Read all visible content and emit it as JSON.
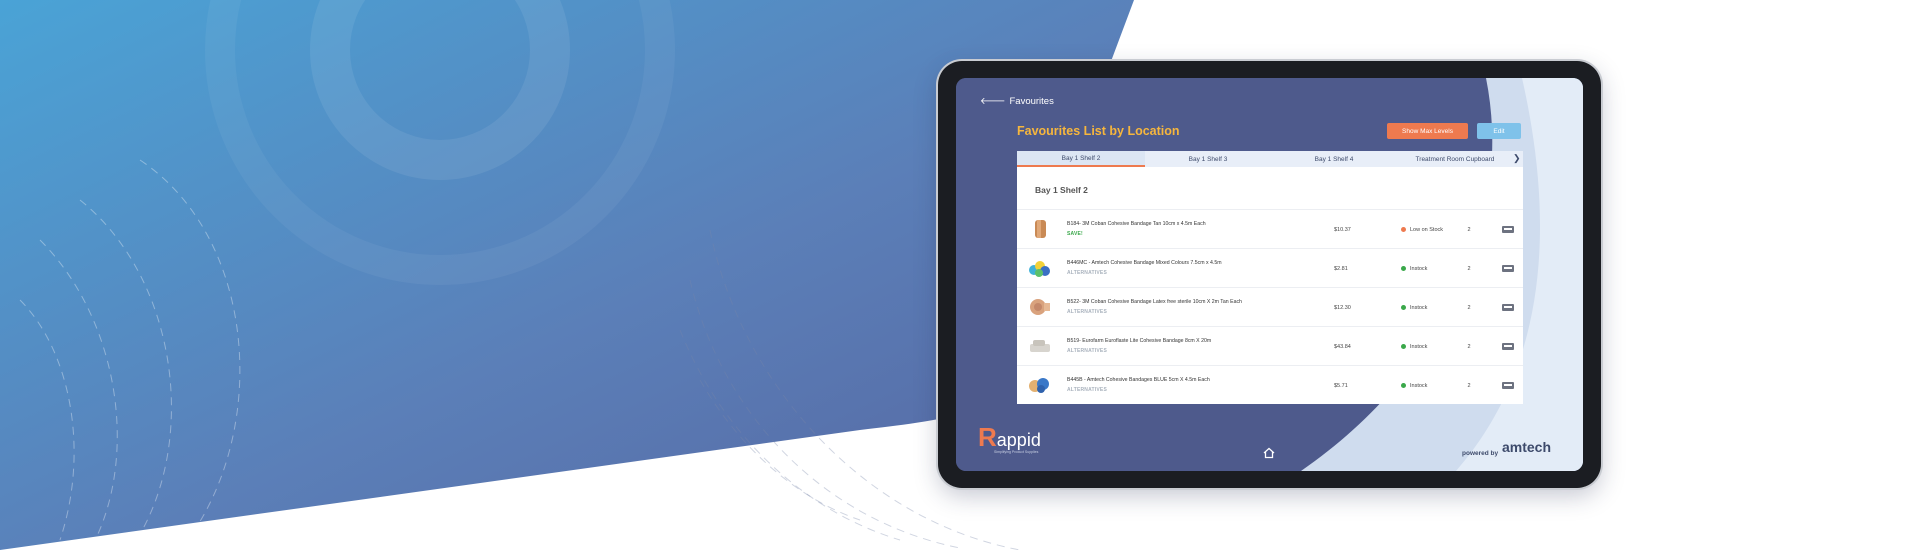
{
  "screen": {
    "back_label": "Favourites",
    "title": "Favourites List by Location",
    "buttons": {
      "show_max_levels": "Show Max Levels",
      "edit": "Edit"
    }
  },
  "tabs": [
    {
      "label": "Bay 1 Shelf 2",
      "active": true
    },
    {
      "label": "Bay 1 Shelf 3",
      "active": false
    },
    {
      "label": "Bay 1 Shelf 4",
      "active": false
    },
    {
      "label": "Treatment Room Cupboard",
      "active": false
    }
  ],
  "shelf_title": "Bay 1 Shelf 2",
  "products": [
    {
      "name": "B184- 3M Coban Cohesive Bandage Tan 10cm x 4.5m Each",
      "tag": "SAVE!",
      "tag_type": "save",
      "price": "$10.37",
      "status": "Low on Stock",
      "status_color": "#ee7a4f",
      "qty": "2"
    },
    {
      "name": "B446MC - Amtech Cohesive Bandage Mixed Colours 7.5cm x 4.5m",
      "tag": "ALTERNATIVES",
      "tag_type": "alt",
      "price": "$2.81",
      "status": "Instock",
      "status_color": "#3aa84a",
      "qty": "2"
    },
    {
      "name": "B522- 3M Coban Cohesive Bandage Latex free sterile  10cm X 2m Tan Each",
      "tag": "ALTERNATIVES",
      "tag_type": "alt",
      "price": "$12.30",
      "status": "Instock",
      "status_color": "#3aa84a",
      "qty": "2"
    },
    {
      "name": "B519- Eurofarm Euroflaste Lite Cohesive Bandage 8cm X 20m",
      "tag": "ALTERNATIVES",
      "tag_type": "alt",
      "price": "$43.84",
      "status": "Instock",
      "status_color": "#3aa84a",
      "qty": "2"
    },
    {
      "name": "B445B - Amtech Cohesive Bandages BLUE 5cm X 4.5m Each",
      "tag": "ALTERNATIVES",
      "tag_type": "alt",
      "price": "$5.71",
      "status": "Instock",
      "status_color": "#3aa84a",
      "qty": "2"
    }
  ],
  "footer": {
    "brand": "appid",
    "brand_initial": "R",
    "tagline": "Simplifying Product Supplies",
    "powered_by": "powered by",
    "partner": "amtech"
  },
  "colors": {
    "accent_orange": "#ee7a4f",
    "title_yellow": "#f6b63d",
    "screen_blue": "#4e5a8c",
    "edit_blue": "#7fc2ea"
  }
}
